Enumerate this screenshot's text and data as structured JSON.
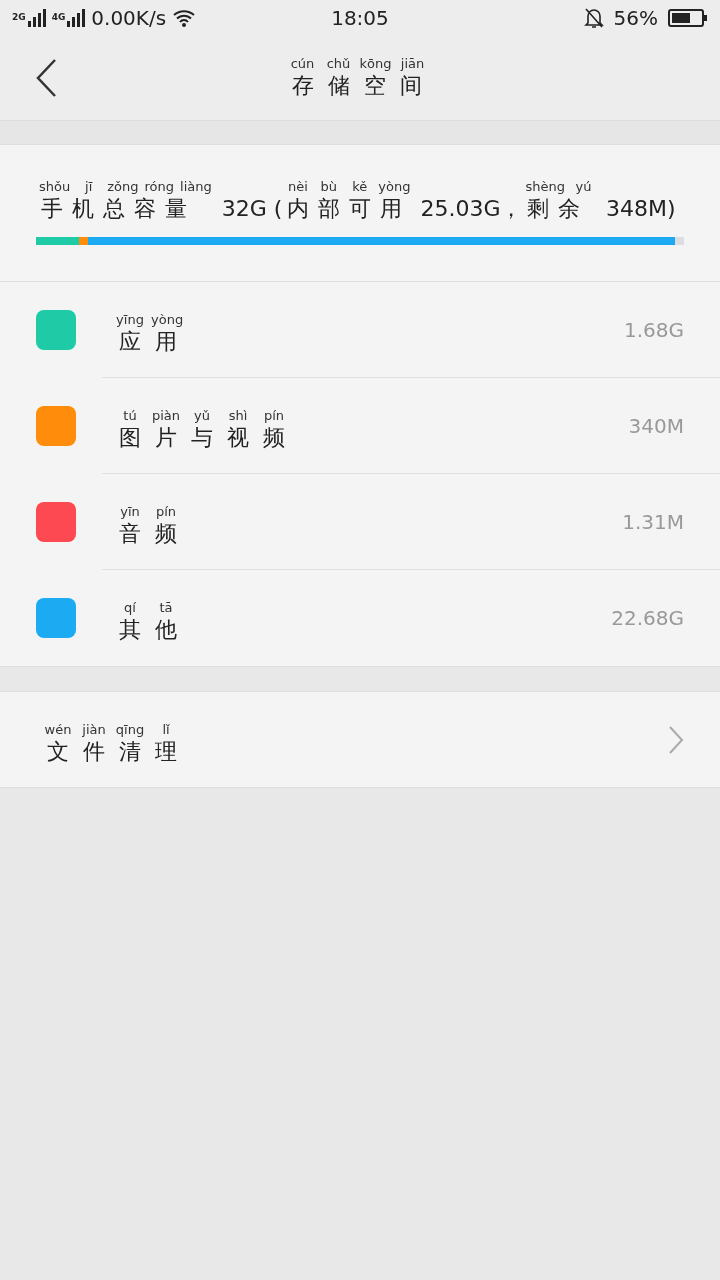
{
  "status_bar": {
    "network_1": "2G",
    "network_2": "4G",
    "speed": "0.00K/s",
    "time": "18:05",
    "battery": "56%"
  },
  "header": {
    "title": "存储空间",
    "pinyin": "cún chǔ kōng jiān"
  },
  "summary": {
    "segments": [
      {
        "text": "手机总容量",
        "pinyin": "shǒu jī zǒng róng liàng"
      },
      {
        "text": " 32G ("
      },
      {
        "text": "内部可用",
        "pinyin": "nèi bù kě yòng"
      },
      {
        "text": " 25.03G，"
      },
      {
        "text": "剩余",
        "pinyin": "shèng yú"
      },
      {
        "text": " 348M)"
      }
    ]
  },
  "categories": [
    {
      "label": "应用",
      "pinyin": "yīng yòng",
      "size": "1.68G",
      "color": "#1ecba6"
    },
    {
      "label": "图片与视频",
      "pinyin": "tú piàn yǔ shì pín",
      "size": "340M",
      "color": "#ff8c0a"
    },
    {
      "label": "音频",
      "pinyin": "yīn pín",
      "size": "1.31M",
      "color": "#fd4a52"
    },
    {
      "label": "其他",
      "pinyin": "qí tā",
      "size": "22.68G",
      "color": "#1cabf2"
    }
  ],
  "cleanup": {
    "label": "文件清理",
    "pinyin": "wén jiàn qīng lǐ"
  }
}
